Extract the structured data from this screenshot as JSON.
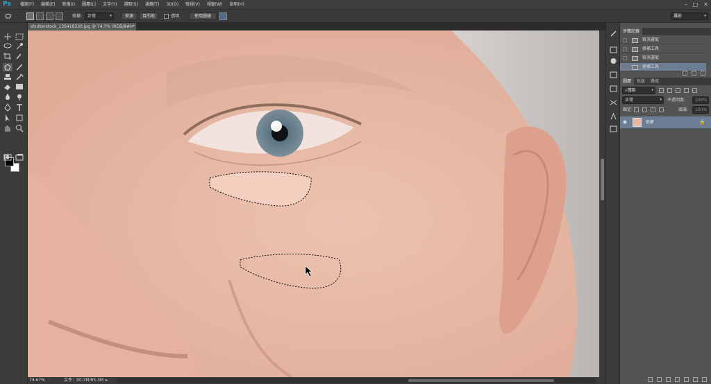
{
  "app": {
    "logo": "Ps"
  },
  "menu": [
    "檔案(F)",
    "編輯(E)",
    "影像(I)",
    "圖層(L)",
    "文字(Y)",
    "選取(S)",
    "濾鏡(T)",
    "3D(D)",
    "檢視(V)",
    "視窗(W)",
    "說明(H)"
  ],
  "window_controls": [
    "–",
    "□",
    "✕"
  ],
  "options": {
    "patch_label": "修補:",
    "patch_mode": "正常",
    "source": "來源",
    "destination": "目的地",
    "transparent": "透明",
    "use_pattern": "使用圖樣",
    "workspace": "攝影"
  },
  "document": {
    "tab_title": "shutterstock_136418330.jpg @ 74.7% (RGB/8#) *",
    "zoom": "74.67%",
    "doc_size": "文件：90.3M/85.3M"
  },
  "history_panel": {
    "tabs": [
      "步驟記錄"
    ],
    "items": [
      {
        "label": "取消選取",
        "active": false
      },
      {
        "label": "修補工具",
        "active": false
      },
      {
        "label": "取消選取",
        "active": false
      },
      {
        "label": "修補工具",
        "active": true
      }
    ]
  },
  "layers_panel": {
    "tabs": [
      "圖層",
      "色版",
      "路徑"
    ],
    "kind_filter": "種類",
    "blend_mode": "正常",
    "opacity_label": "不透明度:",
    "opacity_value": "100%",
    "lock_label": "鎖定:",
    "fill_label": "填滿:",
    "fill_value": "100%",
    "layers": [
      {
        "name": "背景",
        "visible": true,
        "locked": true
      }
    ]
  },
  "colors": {
    "skin": "#e6b9a6",
    "ui_dark": "#3b3b3b",
    "ui_panel": "#535353",
    "selected_row": "#6c7d94",
    "ps_blue": "#33a7e8"
  }
}
